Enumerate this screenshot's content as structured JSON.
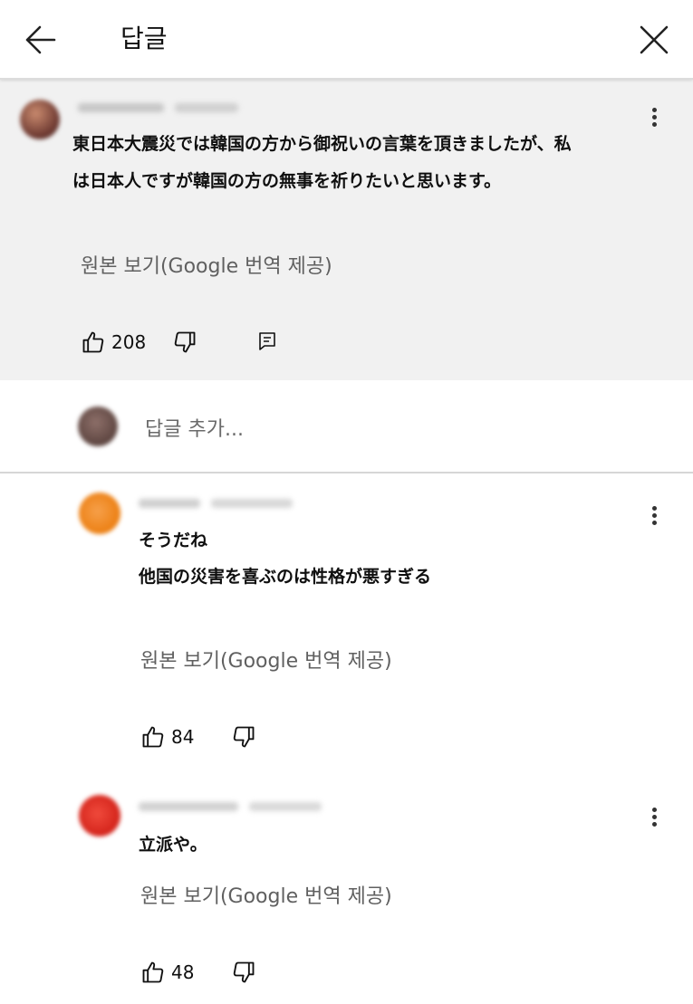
{
  "header": {
    "title": "답글",
    "back_icon": "arrow-left-icon",
    "close_icon": "close-icon"
  },
  "main_comment": {
    "line1": "東日本大震災では韓国の方から御祝いの言葉を頂きましたが、私",
    "line2": "は日本人ですが韓国の方の無事を祈りたいと思います。",
    "translate_label": "원본 보기(Google 번역 제공)",
    "likes": "208"
  },
  "reply_box": {
    "placeholder": "답글 추가..."
  },
  "replies": [
    {
      "line1": "そうだね",
      "line2": "他国の災害を喜ぶのは性格が悪すぎる",
      "translate_label": "원본 보기(Google 번역 제공)",
      "likes": "84",
      "avatar_color": "#f08a1c"
    },
    {
      "line1": "立派や。",
      "translate_label": "원본 보기(Google 번역 제공)",
      "likes": "48",
      "avatar_color": "#d8261c"
    }
  ],
  "colors": {
    "main_background": "#f1f1f1",
    "main_avatar": "#7a4b3e",
    "reply_avatar": "#6b4f4a"
  }
}
